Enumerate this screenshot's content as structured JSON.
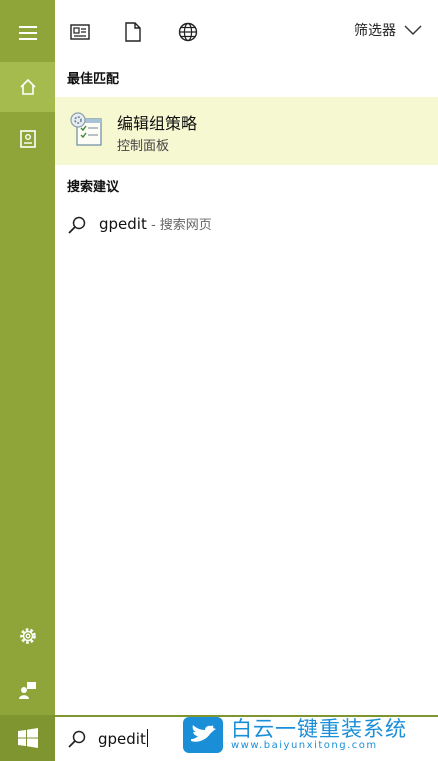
{
  "rail": {
    "menu_icon": "hamburger-icon",
    "home_icon": "home-icon",
    "notebook_icon": "notebook-icon",
    "settings_icon": "gear-icon",
    "feedback_icon": "feedback-icon",
    "start_icon": "windows-logo-icon"
  },
  "toolbar": {
    "apps_icon": "apps-icon",
    "documents_icon": "document-icon",
    "web_icon": "globe-icon",
    "filter_label": "筛选器"
  },
  "best_match": {
    "heading": "最佳匹配",
    "item": {
      "title": "编辑组策略",
      "subtitle": "控制面板",
      "icon": "group-policy-icon"
    }
  },
  "suggestions": {
    "heading": "搜索建议",
    "items": [
      {
        "term": "gpedit",
        "suffix": " - 搜索网页",
        "icon": "search-icon"
      }
    ]
  },
  "search": {
    "value": "gpedit",
    "icon": "search-icon"
  },
  "watermark": {
    "title": "白云一键重装系统",
    "url": "www.baiyunxitong.com"
  },
  "colors": {
    "rail": "#8fa53a",
    "rail_active": "#a6bb4d",
    "highlight": "#f6f8d2",
    "watermark": "#1a8fd8"
  }
}
